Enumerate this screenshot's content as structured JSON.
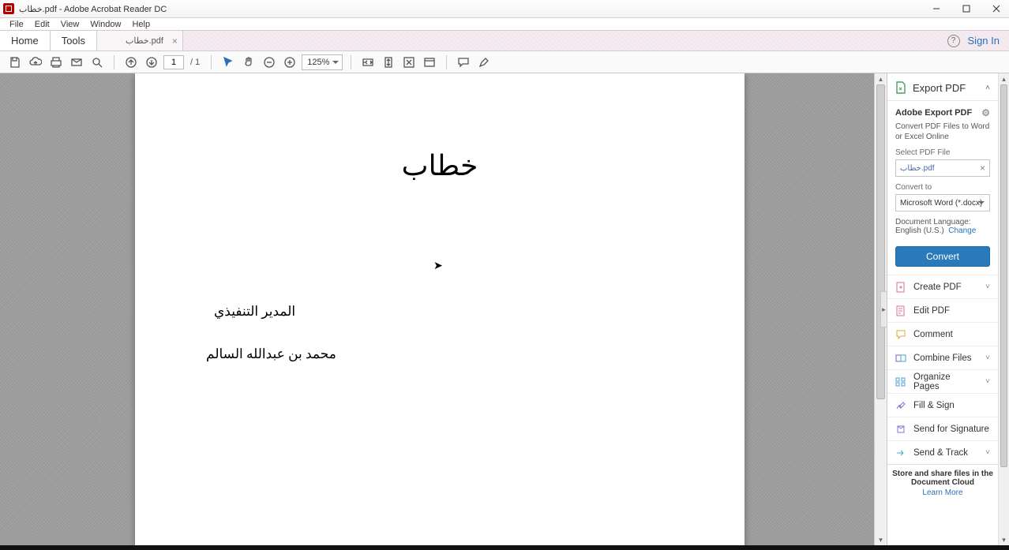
{
  "window": {
    "title": "خطاب.pdf - Adobe Acrobat Reader DC"
  },
  "menu": {
    "file": "File",
    "edit": "Edit",
    "view": "View",
    "window": "Window",
    "help": "Help"
  },
  "tabs": {
    "home": "Home",
    "tools": "Tools",
    "document": "خطاب.pdf",
    "sign_in": "Sign In"
  },
  "toolbar": {
    "page_current": "1",
    "page_total": "/ 1",
    "zoom": "125%"
  },
  "document": {
    "title": "خطاب",
    "line1": "المدير التنفيذي",
    "line2": "محمد بن عبدالله السالم"
  },
  "right_panel": {
    "export_pdf": "Export PDF",
    "adobe_export": "Adobe Export PDF",
    "export_desc": "Convert PDF Files to Word or Excel Online",
    "select_label": "Select PDF File",
    "selected_file": "خطاب.pdf",
    "convert_to_label": "Convert to",
    "convert_to_value": "Microsoft Word (*.docx)",
    "doc_lang_label": "Document Language:",
    "doc_lang_value": "English (U.S.)",
    "change": "Change",
    "convert_btn": "Convert",
    "tools": {
      "create": "Create PDF",
      "edit": "Edit PDF",
      "comment": "Comment",
      "combine": "Combine Files",
      "organize": "Organize Pages",
      "fill_sign": "Fill & Sign",
      "send_sig": "Send for Signature",
      "send_track": "Send & Track"
    },
    "promo": "Store and share files in the Document Cloud",
    "learn_more": "Learn More"
  }
}
